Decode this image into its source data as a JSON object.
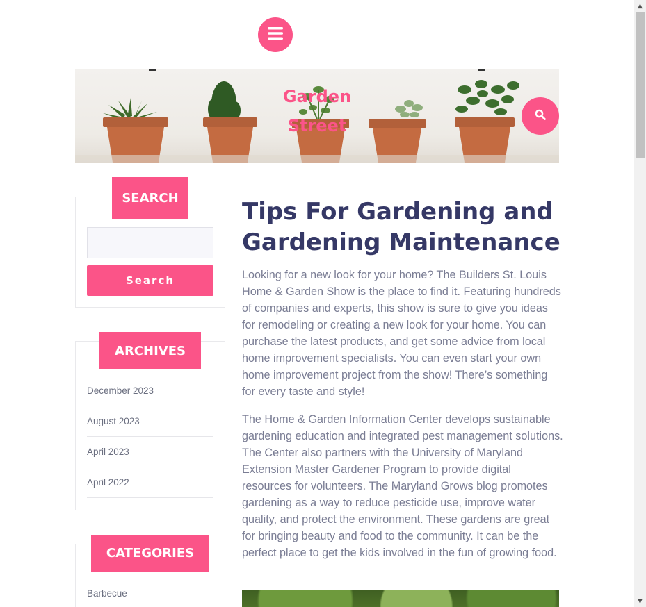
{
  "header": {
    "site_title_line1": "Garden",
    "site_title_line2": "Street",
    "menu_icon": "hamburger-icon",
    "search_icon": "search-icon",
    "accent_color": "#fb5488"
  },
  "sidebar": {
    "search_widget": {
      "title": "SEARCH",
      "input_value": "",
      "button_label": "Search"
    },
    "archives_widget": {
      "title": "ARCHIVES",
      "items": [
        "December 2023",
        "August 2023",
        "April 2023",
        "April 2022"
      ]
    },
    "categories_widget": {
      "title": "CATEGORIES",
      "items": [
        "Barbecue"
      ]
    }
  },
  "post": {
    "title": "Tips For Gardening and Gardening Maintenance",
    "paragraphs": [
      "Looking for a new look for your home? The Builders St. Louis Home & Garden Show is the place to find it. Featuring hundreds of companies and experts, this show is sure to give you ideas for remodeling or creating a new look for your home. You can purchase the latest products, and get some advice from local home improvement specialists. You can even start your own home improvement project from the show! There’s something for every taste and style!",
      "The Home & Garden Information Center develops sustainable gardening education and integrated pest management solutions. The Center also partners with the University of Maryland Extension Master Gardener Program to provide digital resources for volunteers. The Maryland Grows blog promotes gardening as a way to reduce pesticide use, improve water quality, and protect the environment. These gardens are great for bringing beauty and food to the community. It can be the perfect place to get the kids involved in the fun of growing food."
    ]
  },
  "colors": {
    "title_color": "#353866",
    "text_color": "#7a7d94",
    "accent": "#fb5488"
  }
}
